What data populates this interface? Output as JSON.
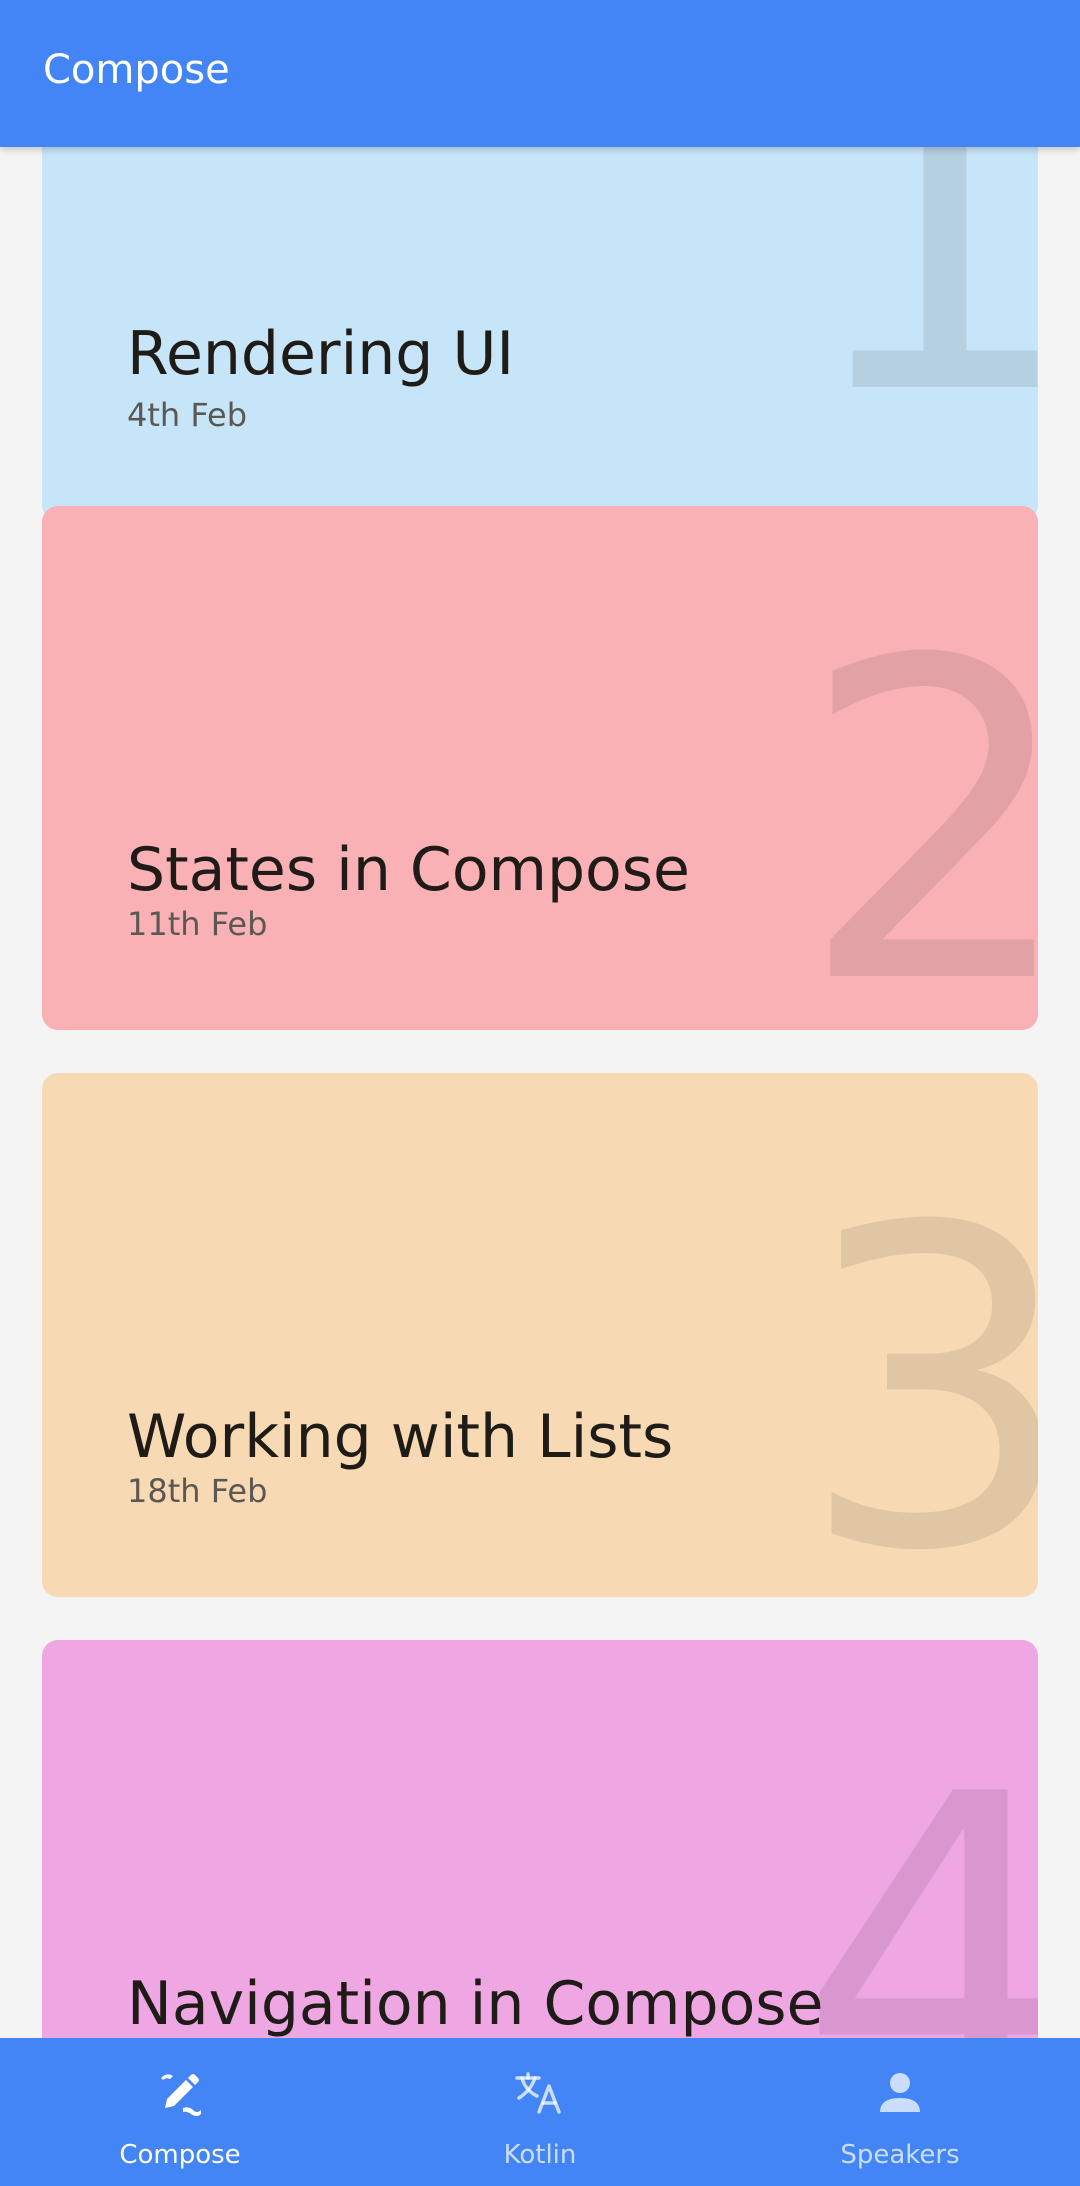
{
  "app_bar": {
    "title": "Compose"
  },
  "cards": [
    {
      "title": "Rendering UI",
      "date": "4th Feb",
      "number": "1",
      "color": "#c7e5f8"
    },
    {
      "title": "States in Compose",
      "date": "11th Feb",
      "number": "2",
      "color": "#f9b1b6"
    },
    {
      "title": "Working with Lists",
      "date": "18th Feb",
      "number": "3",
      "color": "#f7dab4"
    },
    {
      "title": "Navigation in Compose",
      "date": "",
      "number": "4",
      "color": "#eea7e3"
    }
  ],
  "bottom_nav": {
    "items": [
      {
        "label": "Compose",
        "icon": "compose-pencil-icon",
        "active": true
      },
      {
        "label": "Kotlin",
        "icon": "translate-icon",
        "active": false
      },
      {
        "label": "Speakers",
        "icon": "person-icon",
        "active": false
      }
    ],
    "background": "#4385f4"
  }
}
